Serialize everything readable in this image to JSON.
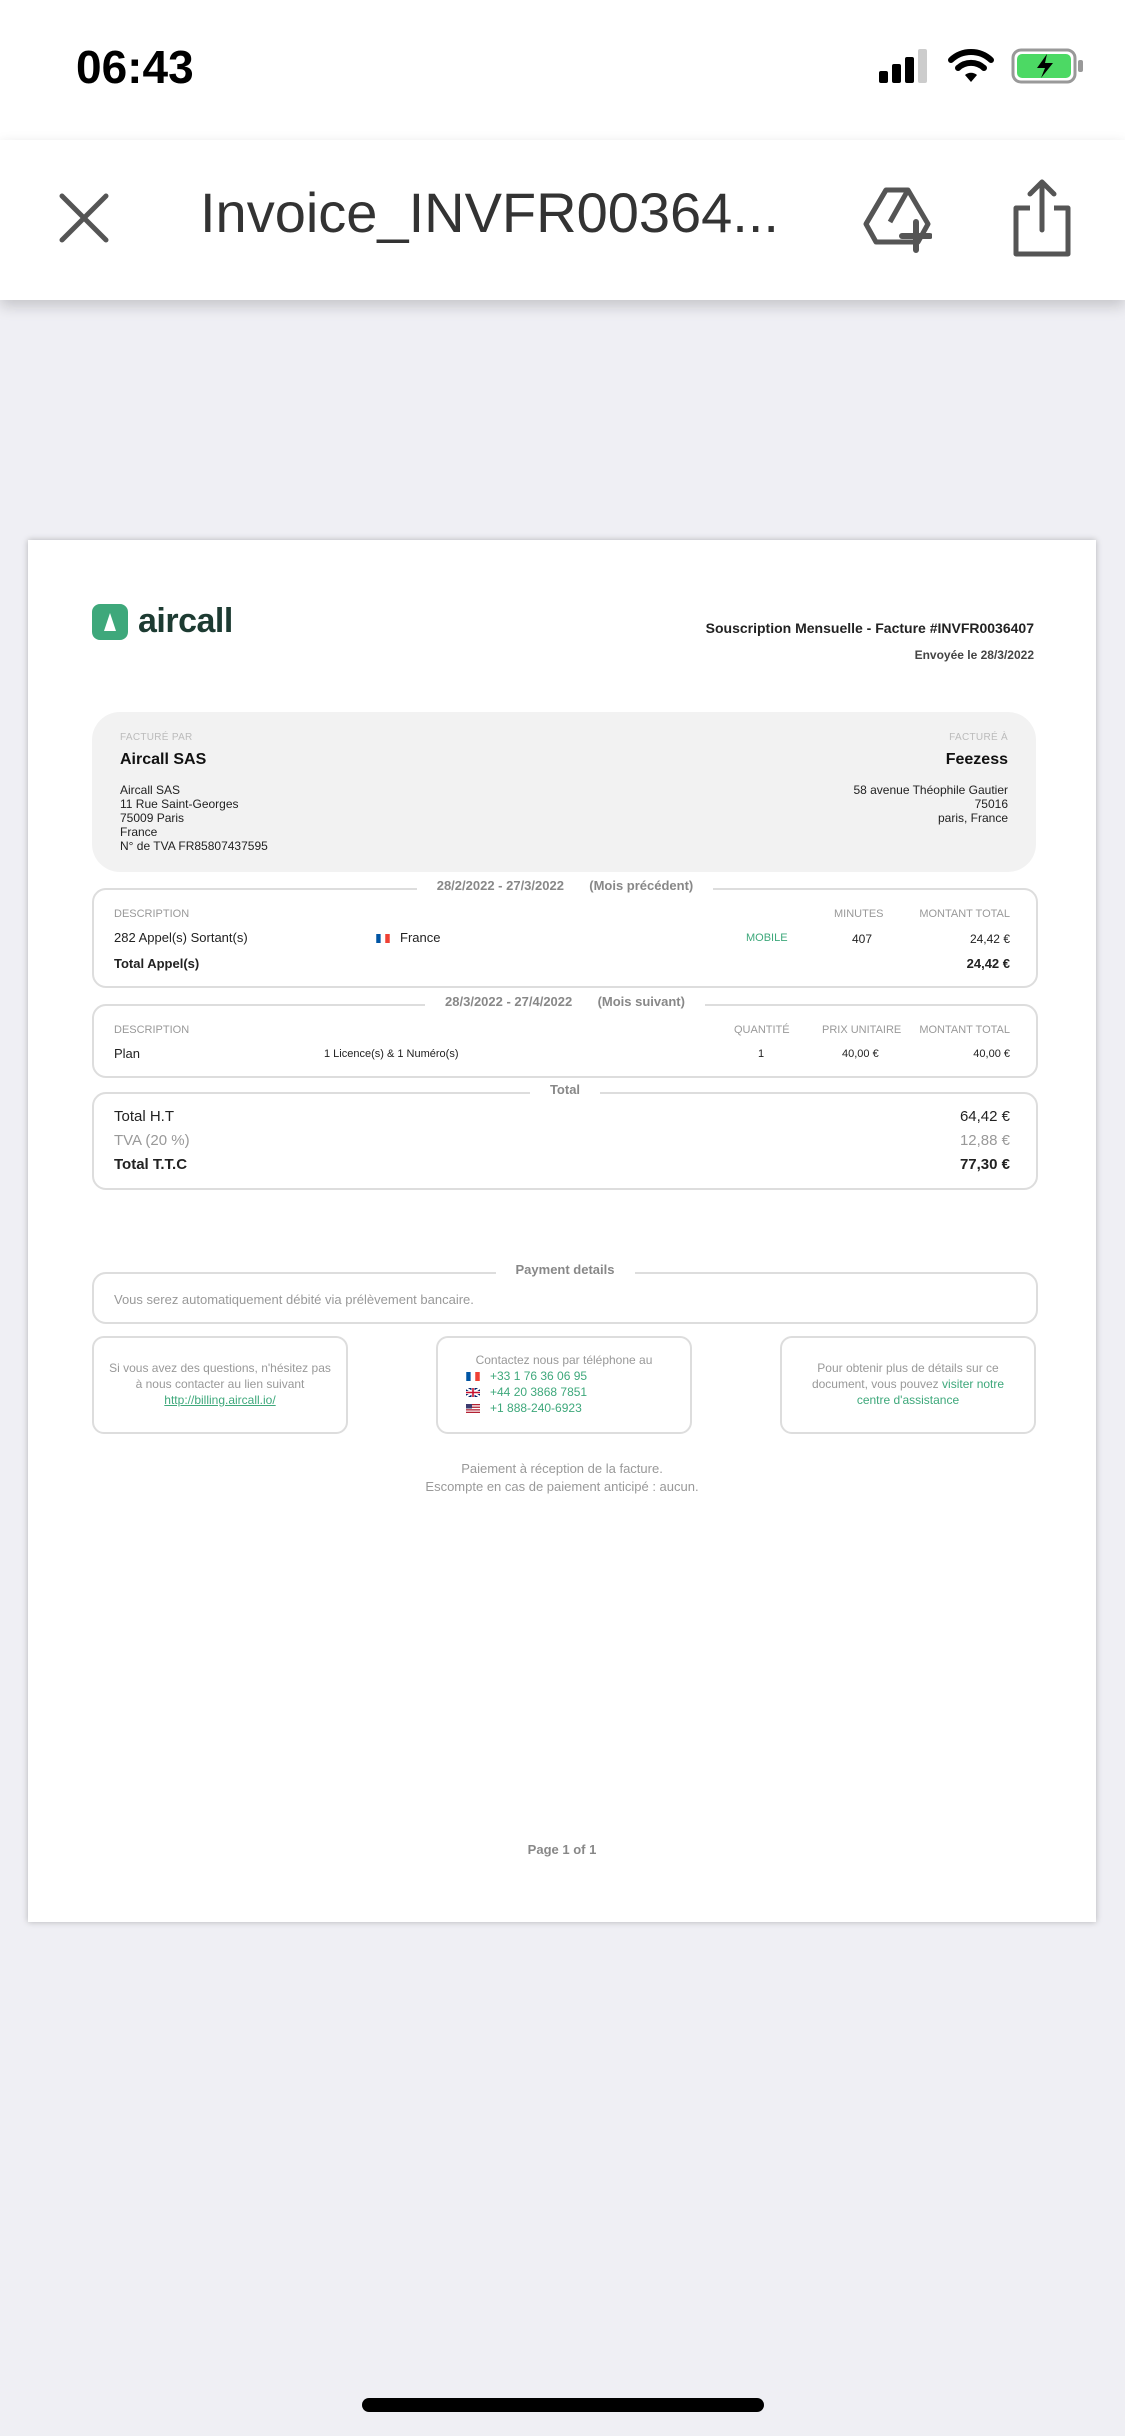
{
  "status_bar": {
    "time": "06:43"
  },
  "nav": {
    "title": "Invoice_INVFR00364..."
  },
  "invoice": {
    "logo_text": "aircall",
    "title": "Souscription Mensuelle - Facture #INVFR0036407",
    "sent": "Envoyée le 28/3/2022",
    "billed_by": {
      "caption": "FACTURÉ PAR",
      "name": "Aircall SAS",
      "lines": [
        "Aircall SAS",
        "11 Rue Saint-Georges",
        "75009 Paris",
        "France",
        "N° de TVA FR85807437595"
      ]
    },
    "billed_to": {
      "caption": "FACTURÉ À",
      "name": "Feezess",
      "lines": [
        "58 avenue Théophile Gautier",
        "75016",
        "paris, France"
      ]
    },
    "calls": {
      "period": "28/2/2022 - 27/3/2022",
      "period_note": "(Mois précédent)",
      "headers": {
        "description": "DESCRIPTION",
        "minutes": "MINUTES",
        "amount": "MONTANT TOTAL"
      },
      "row": {
        "description": "282 Appel(s) Sortant(s)",
        "country": "France",
        "type": "MOBILE",
        "minutes": "407",
        "amount": "24,42 €"
      },
      "total_label": "Total Appel(s)",
      "total_value": "24,42 €"
    },
    "plan": {
      "period": "28/3/2022 - 27/4/2022",
      "period_note": "(Mois suivant)",
      "headers": {
        "description": "DESCRIPTION",
        "quantity": "QUANTITÉ",
        "unit_price": "PRIX UNITAIRE",
        "amount": "MONTANT TOTAL"
      },
      "row": {
        "description": "Plan",
        "detail": "1 Licence(s) & 1 Numéro(s)",
        "quantity": "1",
        "unit_price": "40,00 €",
        "amount": "40,00 €"
      }
    },
    "totals": {
      "legend": "Total",
      "ht_label": "Total H.T",
      "ht_value": "64,42 €",
      "tva_label": "TVA (20 %)",
      "tva_value": "12,88 €",
      "ttc_label": "Total T.T.C",
      "ttc_value": "77,30 €"
    },
    "payment": {
      "legend": "Payment details",
      "text": "Vous serez automatiquement débité via prélèvement bancaire."
    },
    "help": {
      "box1_text": "Si vous avez des questions, n'hésitez pas à nous contacter au lien suivant",
      "box1_link": "http://billing.aircall.io/",
      "box2_title": "Contactez nous par téléphone au",
      "phone_fr": "+33 1 76 36 06 95",
      "phone_uk": "+44 20 3868 7851",
      "phone_us": "+1 888-240-6923",
      "box3_text": "Pour obtenir plus de détails sur ce document, vous pouvez",
      "box3_link": "visiter notre centre d'assistance"
    },
    "footer_line1": "Paiement à réception de la facture.",
    "footer_line2": "Escompte en cas de paiement anticipé : aucun.",
    "page_number": "Page 1 of 1"
  }
}
